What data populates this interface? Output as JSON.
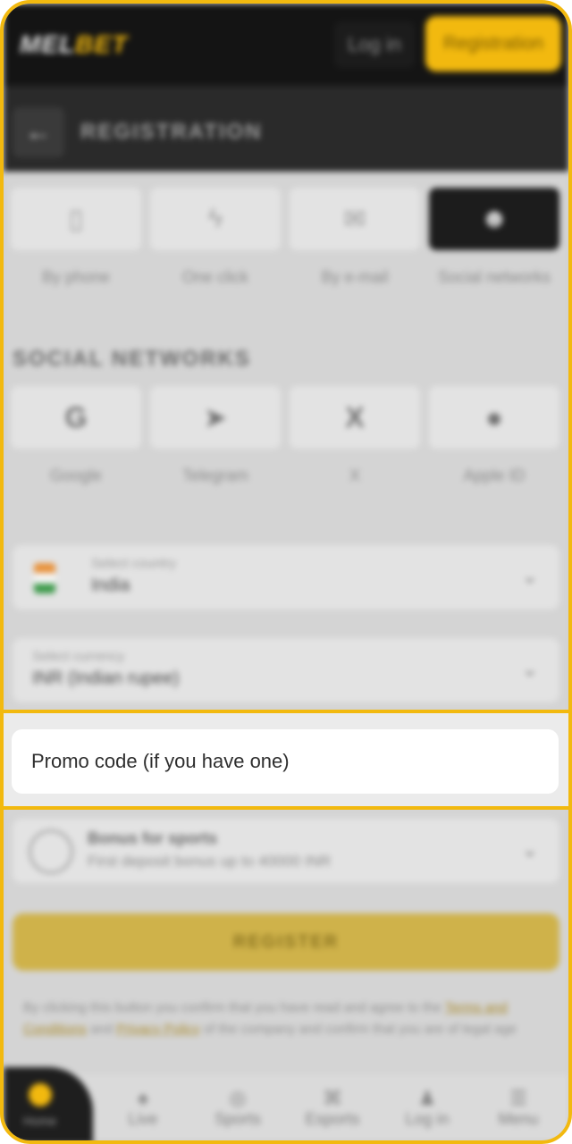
{
  "header": {
    "logo_part1": "MEL",
    "logo_part2": "BET",
    "login_label": "Log in",
    "registration_label": "Registration"
  },
  "subheader": {
    "back_icon": "arrow-left-icon",
    "title": "REGISTRATION"
  },
  "methods": [
    {
      "label": "By phone",
      "icon": "phone-icon"
    },
    {
      "label": "One click",
      "icon": "lightning-icon"
    },
    {
      "label": "By e-mail",
      "icon": "envelope-icon"
    },
    {
      "label": "Social networks",
      "icon": "people-icon",
      "active": true
    }
  ],
  "social_section_title": "SOCIAL NETWORKS",
  "socials": [
    {
      "label": "Google",
      "icon": "google-icon"
    },
    {
      "label": "Telegram",
      "icon": "telegram-icon"
    },
    {
      "label": "X",
      "icon": "x-icon"
    },
    {
      "label": "Apple ID",
      "icon": "apple-icon"
    }
  ],
  "country": {
    "caption": "Select country",
    "value": "India"
  },
  "currency": {
    "caption": "Select currency",
    "value": "INR (Indian rupee)"
  },
  "promo": {
    "placeholder": "Promo code (if you have one)"
  },
  "bonus": {
    "title": "Bonus for sports",
    "subtitle": "First deposit bonus up to 40000 INR"
  },
  "register_label": "REGISTER",
  "terms": {
    "before": "By clicking this button you confirm that you have read and agree to the",
    "terms_link": "Terms and Conditions",
    "middle": "and",
    "privacy_link": "Privacy Policy",
    "after": "of the company and confirm that you are of legal age"
  },
  "nav": [
    {
      "label": "Home",
      "icon": "home-icon"
    },
    {
      "label": "Live",
      "icon": "flame-icon"
    },
    {
      "label": "Sports",
      "icon": "ball-icon"
    },
    {
      "label": "Esports",
      "icon": "gamepad-icon"
    },
    {
      "label": "Log in",
      "icon": "user-icon"
    },
    {
      "label": "Menu",
      "icon": "menu-icon"
    }
  ],
  "colors": {
    "accent": "#f2b90f",
    "dark": "#141414"
  }
}
